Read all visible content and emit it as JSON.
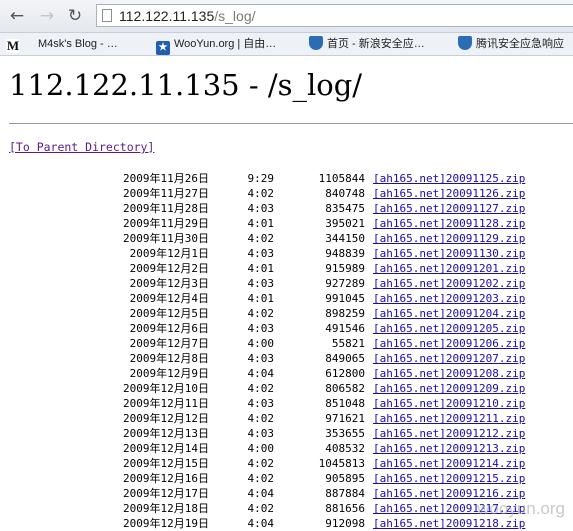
{
  "browser": {
    "url_host": "112.122.11.135",
    "url_path": "/s_log/",
    "bookmarks": [
      {
        "icon": "m-logo-icon",
        "label": "M4sk's Blog - …"
      },
      {
        "icon": "wooyun-icon",
        "label": "WooYun.org | 自由…"
      },
      {
        "icon": "shield-icon",
        "label": "首页 - 新浪安全应…"
      },
      {
        "icon": "shield-icon",
        "label": "腾讯安全应急响应"
      }
    ]
  },
  "page": {
    "title": "112.122.11.135 - /s_log/",
    "parent_link": "[To Parent Directory]",
    "files": [
      {
        "date": "2009年11月26日",
        "time": "9:29",
        "size": "1105844",
        "name": "[ah165.net]20091125.zip"
      },
      {
        "date": "2009年11月27日",
        "time": "4:02",
        "size": "840748",
        "name": "[ah165.net]20091126.zip"
      },
      {
        "date": "2009年11月28日",
        "time": "4:03",
        "size": "835475",
        "name": "[ah165.net]20091127.zip"
      },
      {
        "date": "2009年11月29日",
        "time": "4:01",
        "size": "395021",
        "name": "[ah165.net]20091128.zip"
      },
      {
        "date": "2009年11月30日",
        "time": "4:02",
        "size": "344150",
        "name": "[ah165.net]20091129.zip"
      },
      {
        "date": "2009年12月1日",
        "time": "4:03",
        "size": "948839",
        "name": "[ah165.net]20091130.zip"
      },
      {
        "date": "2009年12月2日",
        "time": "4:01",
        "size": "915989",
        "name": "[ah165.net]20091201.zip"
      },
      {
        "date": "2009年12月3日",
        "time": "4:03",
        "size": "927289",
        "name": "[ah165.net]20091202.zip"
      },
      {
        "date": "2009年12月4日",
        "time": "4:01",
        "size": "991045",
        "name": "[ah165.net]20091203.zip"
      },
      {
        "date": "2009年12月5日",
        "time": "4:02",
        "size": "898259",
        "name": "[ah165.net]20091204.zip"
      },
      {
        "date": "2009年12月6日",
        "time": "4:03",
        "size": "491546",
        "name": "[ah165.net]20091205.zip"
      },
      {
        "date": "2009年12月7日",
        "time": "4:00",
        "size": "55821",
        "name": "[ah165.net]20091206.zip"
      },
      {
        "date": "2009年12月8日",
        "time": "4:03",
        "size": "849065",
        "name": "[ah165.net]20091207.zip"
      },
      {
        "date": "2009年12月9日",
        "time": "4:04",
        "size": "612800",
        "name": "[ah165.net]20091208.zip"
      },
      {
        "date": "2009年12月10日",
        "time": "4:02",
        "size": "806582",
        "name": "[ah165.net]20091209.zip"
      },
      {
        "date": "2009年12月11日",
        "time": "4:03",
        "size": "851048",
        "name": "[ah165.net]20091210.zip"
      },
      {
        "date": "2009年12月12日",
        "time": "4:02",
        "size": "971621",
        "name": "[ah165.net]20091211.zip"
      },
      {
        "date": "2009年12月13日",
        "time": "4:03",
        "size": "353655",
        "name": "[ah165.net]20091212.zip"
      },
      {
        "date": "2009年12月14日",
        "time": "4:00",
        "size": "408532",
        "name": "[ah165.net]20091213.zip"
      },
      {
        "date": "2009年12月15日",
        "time": "4:02",
        "size": "1045813",
        "name": "[ah165.net]20091214.zip"
      },
      {
        "date": "2009年12月16日",
        "time": "4:02",
        "size": "905895",
        "name": "[ah165.net]20091215.zip"
      },
      {
        "date": "2009年12月17日",
        "time": "4:04",
        "size": "887884",
        "name": "[ah165.net]20091216.zip"
      },
      {
        "date": "2009年12月18日",
        "time": "4:02",
        "size": "881656",
        "name": "[ah165.net]20091217.zip"
      },
      {
        "date": "2009年12月19日",
        "time": "4:04",
        "size": "912098",
        "name": "[ah165.net]20091218.zip"
      }
    ]
  },
  "watermark": "wooyun.org"
}
